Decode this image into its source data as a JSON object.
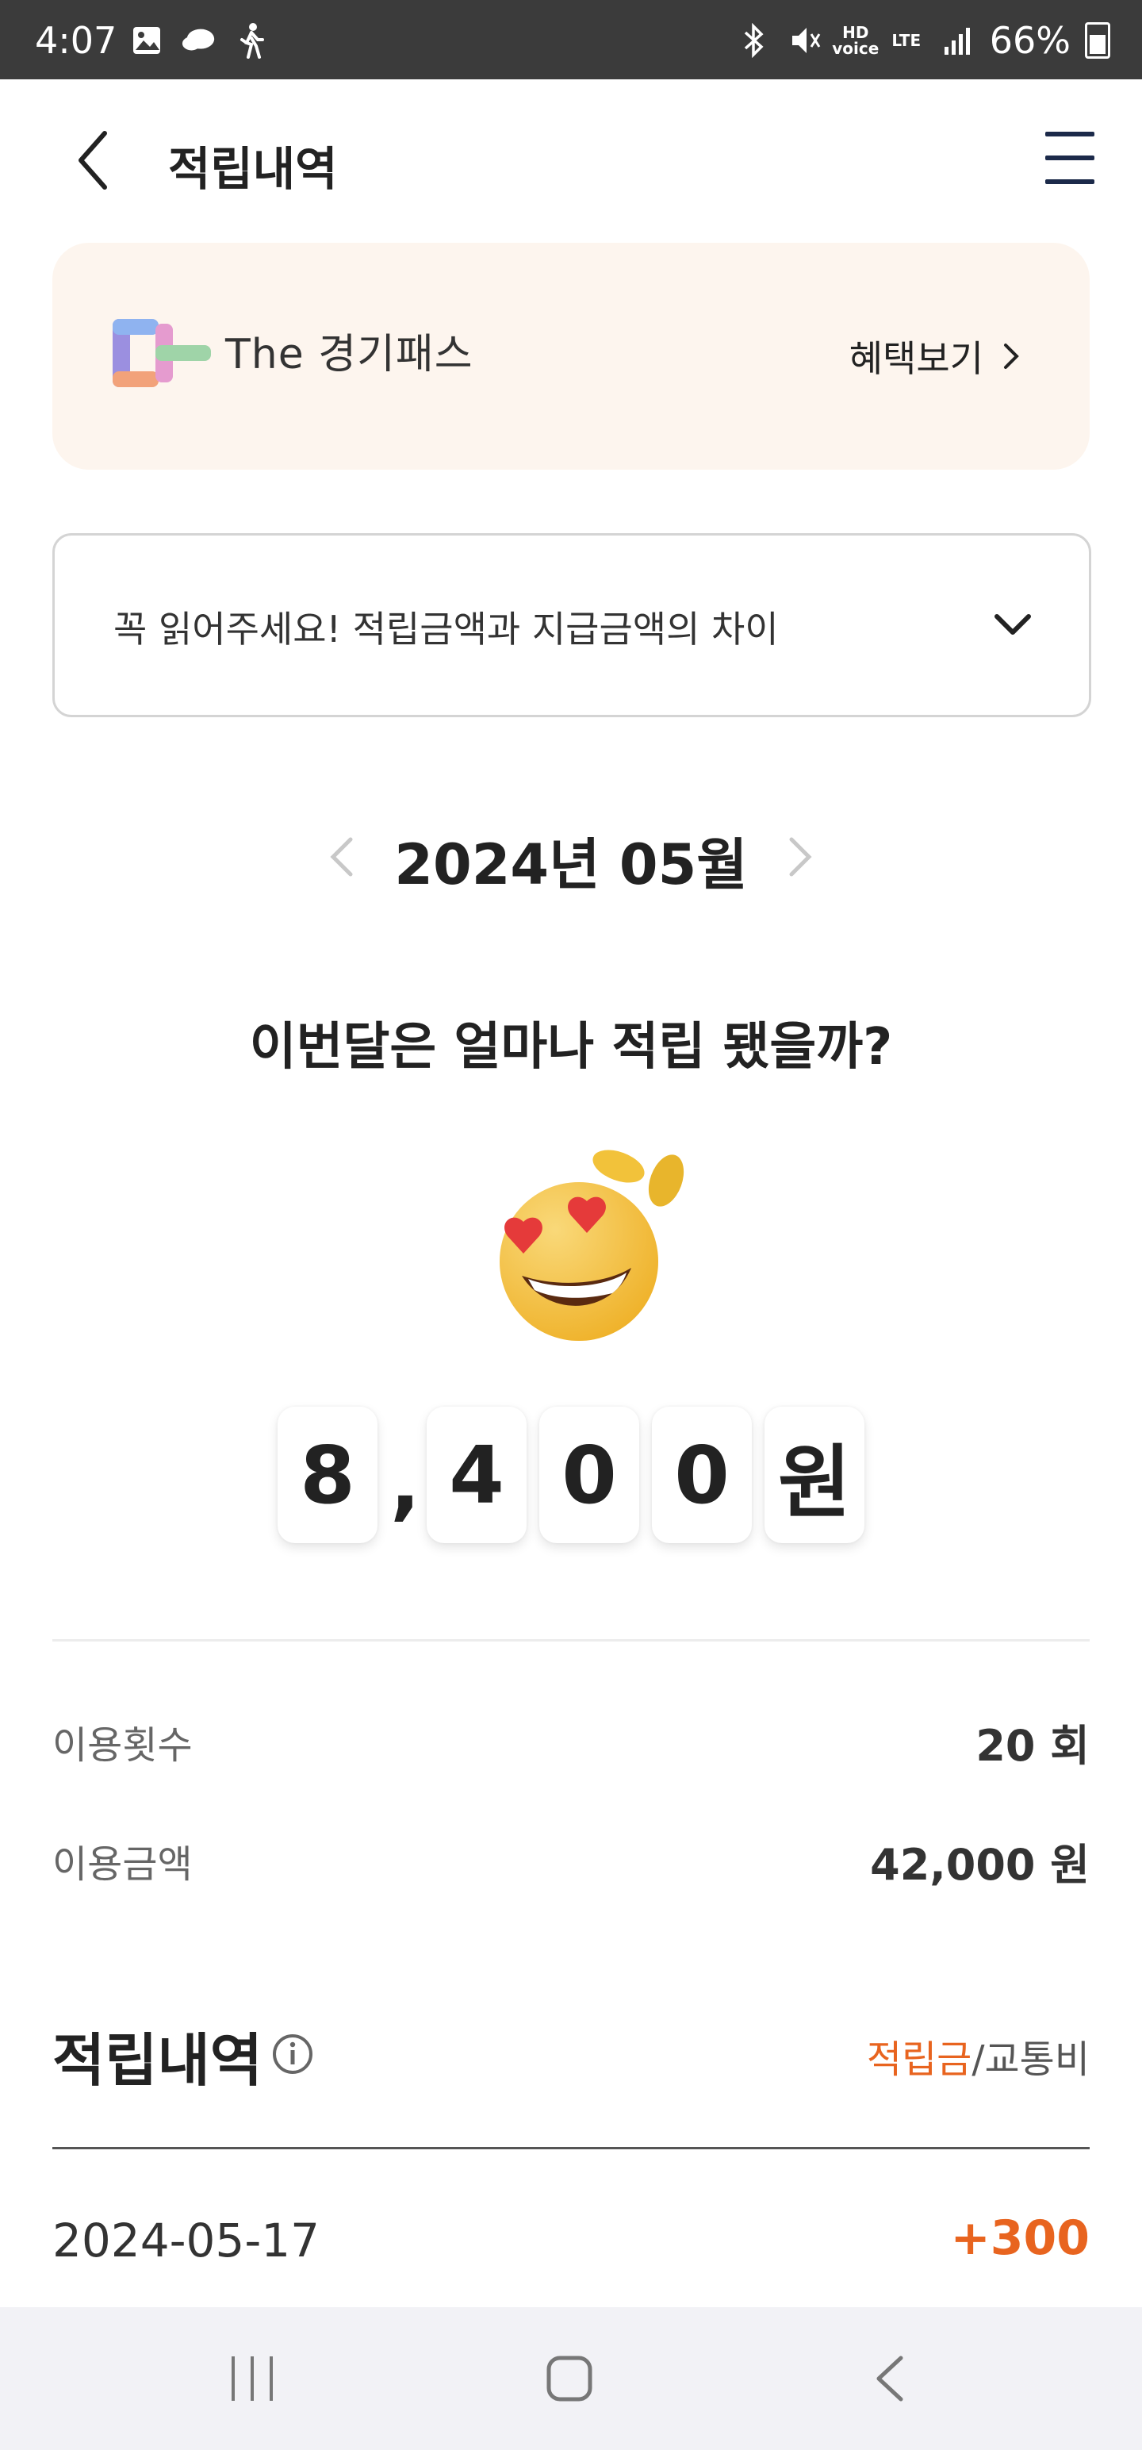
{
  "status_bar": {
    "time": "4:07",
    "network": "LTE",
    "hd_voice": "HD voice",
    "battery": "66%",
    "icons_left": [
      "gallery-icon",
      "cloud-icon",
      "walking-icon"
    ],
    "icons_right": [
      "bluetooth-icon",
      "mute-icon",
      "hd-voice-icon",
      "lte-icon",
      "signal-icon",
      "battery-icon"
    ]
  },
  "header": {
    "title": "적립내역"
  },
  "banner": {
    "brand": "The 경기패스",
    "benefit_label": "혜택보기"
  },
  "notice": {
    "text": "꼭 읽어주세요! 적립금액과 지급금액의 차이"
  },
  "month": {
    "label": "2024년 05월"
  },
  "summary": {
    "question": "이번달은 얼마나 적립 됐을까?",
    "amount_digits": [
      "8",
      ",",
      "4",
      "0",
      "0",
      "원"
    ]
  },
  "stats": {
    "usage_count_label": "이용횟수",
    "usage_count_value": "20 회",
    "usage_amount_label": "이용금액",
    "usage_amount_value": "42,000 원"
  },
  "history": {
    "title": "적립내역",
    "filter_active": "적립금",
    "filter_separator": "/",
    "filter_inactive": "교통비",
    "items": [
      {
        "date": "2024-05-17",
        "amount": "+300"
      }
    ]
  },
  "colors": {
    "accent": "#e8641f",
    "banner_bg": "#fdf5ee",
    "menu_icon": "#1c2a4a"
  }
}
